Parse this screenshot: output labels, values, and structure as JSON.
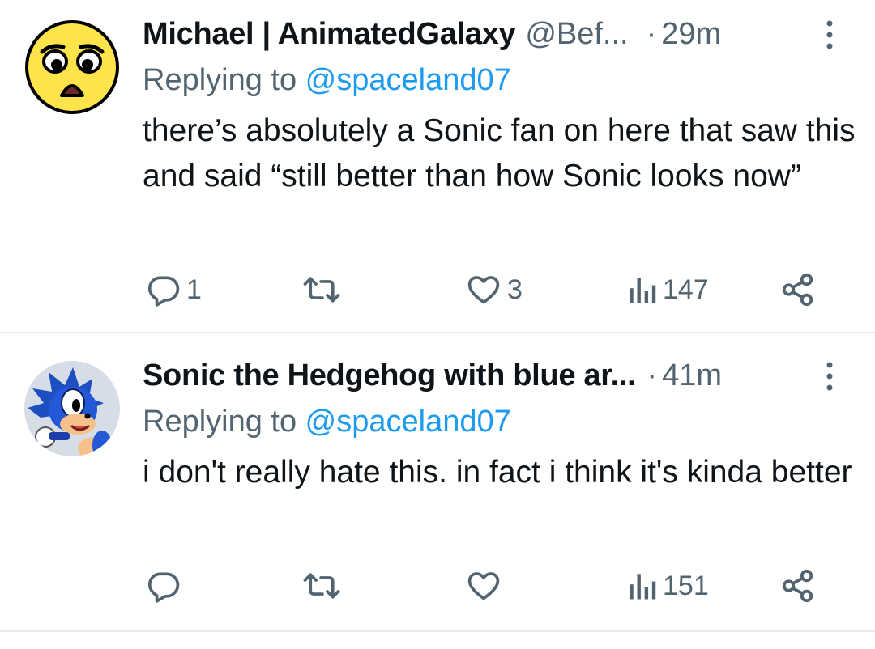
{
  "tweets": [
    {
      "author_name": "Michael | AnimatedGalaxy",
      "handle": "@Bef...",
      "separator": "·",
      "time": "29m",
      "replying_prefix": "Replying to ",
      "replying_to": "@spaceland07",
      "text": "there’s absolutely a Sonic fan on here that saw this and said “still better than how Sonic looks now”",
      "avatar_icon": "worried-face-emoji",
      "reply_count": "1",
      "retweet_count": "",
      "like_count": "3",
      "view_count": "147"
    },
    {
      "author_name": "Sonic the Hedgehog with blue ar...",
      "handle": "",
      "separator": "·",
      "time": "41m",
      "replying_prefix": "Replying to ",
      "replying_to": "@spaceland07",
      "text": "i don't really hate this. in fact i think it's kinda better",
      "avatar_icon": "sonic-cartoon-avatar",
      "reply_count": "",
      "retweet_count": "",
      "like_count": "",
      "view_count": "151"
    }
  ],
  "icons": {
    "reply": "reply-icon",
    "retweet": "retweet-icon",
    "like": "heart-icon",
    "views": "views-icon",
    "share": "share-icon",
    "more": "more-icon"
  },
  "colors": {
    "text": "#0f1419",
    "secondary": "#536471",
    "link": "#1d9bf0",
    "divider": "#e7e9ea",
    "emoji_yellow": "#fde44a"
  }
}
